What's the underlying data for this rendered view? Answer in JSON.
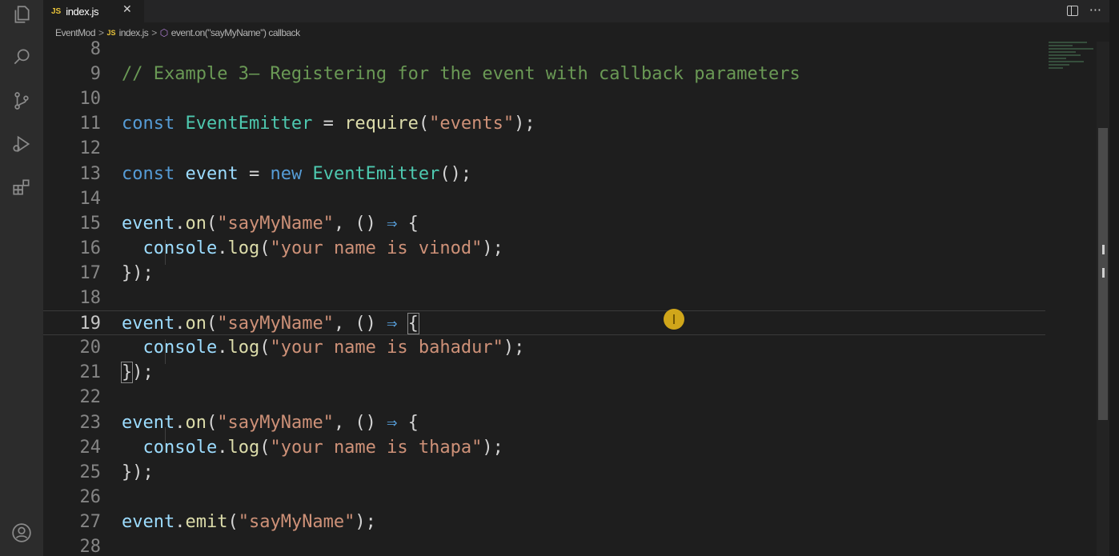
{
  "tab": {
    "badge": "JS",
    "label": "index.js",
    "close": "✕"
  },
  "tab_actions": {
    "more": "···"
  },
  "breadcrumb": {
    "folder": "EventMod",
    "file_badge": "JS",
    "file": "index.js",
    "symbol": "event.on(\"sayMyName\") callback"
  },
  "editor": {
    "current_line": 19,
    "lines": [
      {
        "num": "8",
        "tokens": []
      },
      {
        "num": "9",
        "tokens": [
          {
            "c": "t-comment",
            "t": "// Example 3— Registering for the event with callback parameters"
          }
        ]
      },
      {
        "num": "10",
        "tokens": []
      },
      {
        "num": "11",
        "tokens": [
          {
            "c": "t-keyword",
            "t": "const "
          },
          {
            "c": "t-class",
            "t": "EventEmitter"
          },
          {
            "c": "t-punct",
            "t": " = "
          },
          {
            "c": "t-func",
            "t": "require"
          },
          {
            "c": "t-punct",
            "t": "("
          },
          {
            "c": "t-string",
            "t": "\"events\""
          },
          {
            "c": "t-punct",
            "t": ");"
          }
        ]
      },
      {
        "num": "12",
        "tokens": []
      },
      {
        "num": "13",
        "tokens": [
          {
            "c": "t-keyword",
            "t": "const "
          },
          {
            "c": "t-var",
            "t": "event"
          },
          {
            "c": "t-punct",
            "t": " = "
          },
          {
            "c": "t-keyword",
            "t": "new "
          },
          {
            "c": "t-class",
            "t": "EventEmitter"
          },
          {
            "c": "t-punct",
            "t": "();"
          }
        ]
      },
      {
        "num": "14",
        "tokens": []
      },
      {
        "num": "15",
        "tokens": [
          {
            "c": "t-var",
            "t": "event"
          },
          {
            "c": "t-punct",
            "t": "."
          },
          {
            "c": "t-func",
            "t": "on"
          },
          {
            "c": "t-punct",
            "t": "("
          },
          {
            "c": "t-string",
            "t": "\"sayMyName\""
          },
          {
            "c": "t-punct",
            "t": ", () "
          },
          {
            "c": "t-arrow",
            "t": "⇒"
          },
          {
            "c": "t-punct",
            "t": " {"
          }
        ]
      },
      {
        "num": "16",
        "tokens": [
          {
            "c": "t-punct",
            "t": "  "
          },
          {
            "c": "t-var",
            "t": "console"
          },
          {
            "c": "t-punct",
            "t": "."
          },
          {
            "c": "t-func",
            "t": "log"
          },
          {
            "c": "t-punct",
            "t": "("
          },
          {
            "c": "t-string",
            "t": "\"your name is vinod\""
          },
          {
            "c": "t-punct",
            "t": ");"
          }
        ]
      },
      {
        "num": "17",
        "tokens": [
          {
            "c": "t-punct",
            "t": "});"
          }
        ]
      },
      {
        "num": "18",
        "tokens": []
      },
      {
        "num": "19",
        "tokens": [
          {
            "c": "t-var",
            "t": "event"
          },
          {
            "c": "t-punct",
            "t": "."
          },
          {
            "c": "t-func",
            "t": "on"
          },
          {
            "c": "t-punct",
            "t": "("
          },
          {
            "c": "t-string",
            "t": "\"sayMyName\""
          },
          {
            "c": "t-punct",
            "t": ", () "
          },
          {
            "c": "t-arrow",
            "t": "⇒"
          },
          {
            "c": "t-punct",
            "t": " "
          },
          {
            "c": "t-punct bracket-box",
            "t": "{"
          }
        ]
      },
      {
        "num": "20",
        "tokens": [
          {
            "c": "t-punct",
            "t": "  "
          },
          {
            "c": "t-var",
            "t": "console"
          },
          {
            "c": "t-punct",
            "t": "."
          },
          {
            "c": "t-func",
            "t": "log"
          },
          {
            "c": "t-punct",
            "t": "("
          },
          {
            "c": "t-string",
            "t": "\"your name is bahadur\""
          },
          {
            "c": "t-punct",
            "t": ");"
          }
        ]
      },
      {
        "num": "21",
        "tokens": [
          {
            "c": "t-punct bracket-box",
            "t": "}"
          },
          {
            "c": "t-punct",
            "t": ");"
          }
        ]
      },
      {
        "num": "22",
        "tokens": []
      },
      {
        "num": "23",
        "tokens": [
          {
            "c": "t-var",
            "t": "event"
          },
          {
            "c": "t-punct",
            "t": "."
          },
          {
            "c": "t-func",
            "t": "on"
          },
          {
            "c": "t-punct",
            "t": "("
          },
          {
            "c": "t-string",
            "t": "\"sayMyName\""
          },
          {
            "c": "t-punct",
            "t": ", () "
          },
          {
            "c": "t-arrow",
            "t": "⇒"
          },
          {
            "c": "t-punct",
            "t": " {"
          }
        ]
      },
      {
        "num": "24",
        "tokens": [
          {
            "c": "t-punct",
            "t": "  "
          },
          {
            "c": "t-var",
            "t": "console"
          },
          {
            "c": "t-punct",
            "t": "."
          },
          {
            "c": "t-func",
            "t": "log"
          },
          {
            "c": "t-punct",
            "t": "("
          },
          {
            "c": "t-string",
            "t": "\"your name is thapa\""
          },
          {
            "c": "t-punct",
            "t": ");"
          }
        ]
      },
      {
        "num": "25",
        "tokens": [
          {
            "c": "t-punct",
            "t": "});"
          }
        ]
      },
      {
        "num": "26",
        "tokens": []
      },
      {
        "num": "27",
        "tokens": [
          {
            "c": "t-var",
            "t": "event"
          },
          {
            "c": "t-punct",
            "t": "."
          },
          {
            "c": "t-func",
            "t": "emit"
          },
          {
            "c": "t-punct",
            "t": "("
          },
          {
            "c": "t-string",
            "t": "\"sayMyName\""
          },
          {
            "c": "t-punct",
            "t": ");"
          }
        ]
      },
      {
        "num": "28",
        "tokens": []
      }
    ]
  },
  "activity_icons": [
    "explorer-icon",
    "search-icon",
    "source-control-icon",
    "run-debug-icon",
    "extensions-icon",
    "account-icon"
  ]
}
